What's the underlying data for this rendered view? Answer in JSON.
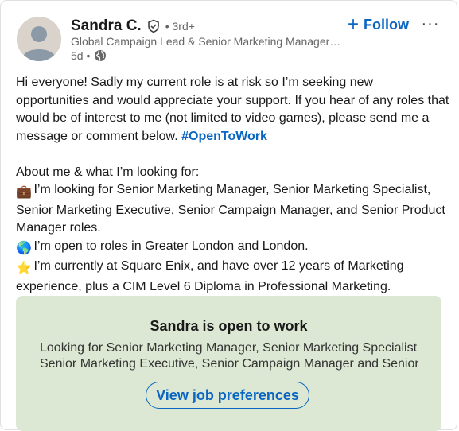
{
  "author": {
    "name": "Sandra C.",
    "degree": "• 3rd+",
    "headline": "Global Campaign Lead & Senior Marketing Manager a...",
    "time": "5d •",
    "verified_icon": "shield-check-icon",
    "visibility_icon": "globe-icon"
  },
  "actions": {
    "follow_icon": "+",
    "follow_label": "Follow",
    "more_label": "···"
  },
  "post": {
    "intro": "Hi everyone! Sadly my current role is at risk so I’m seeking new opportunities and would appreciate your support. If you hear of any roles that would be of interest to me (not limited to video games), please send me a message or comment below. ",
    "hashtag": "#OpenToWork",
    "about_heading": "About me & what I’m looking for:",
    "line1_emoji": "💼",
    "line1": " I’m looking for Senior Marketing Manager, Senior Marketing Specialist, Senior Marketing Executive, Senior Campaign Manager, and Senior Product Manager roles.",
    "line2_emoji": "🌎",
    "line2": " I’m open to roles in Greater London and London.",
    "line3_emoji": "⭐",
    "line3": " I’m currently at Square Enix, and have over 12 years of Marketing experience, plus a CIM Level 6 Diploma in Professional Marketing."
  },
  "open_to_work": {
    "title": "Sandra is open to work",
    "description_line1": "Looking for Senior Marketing Manager, Senior Marketing Specialist,",
    "description_line2": "Senior Marketing Executive, Senior Campaign Manager and Senior…",
    "button_label": "View job preferences"
  },
  "colors": {
    "link": "#0a66c2",
    "open_to_work_bg": "#dce8d3"
  }
}
